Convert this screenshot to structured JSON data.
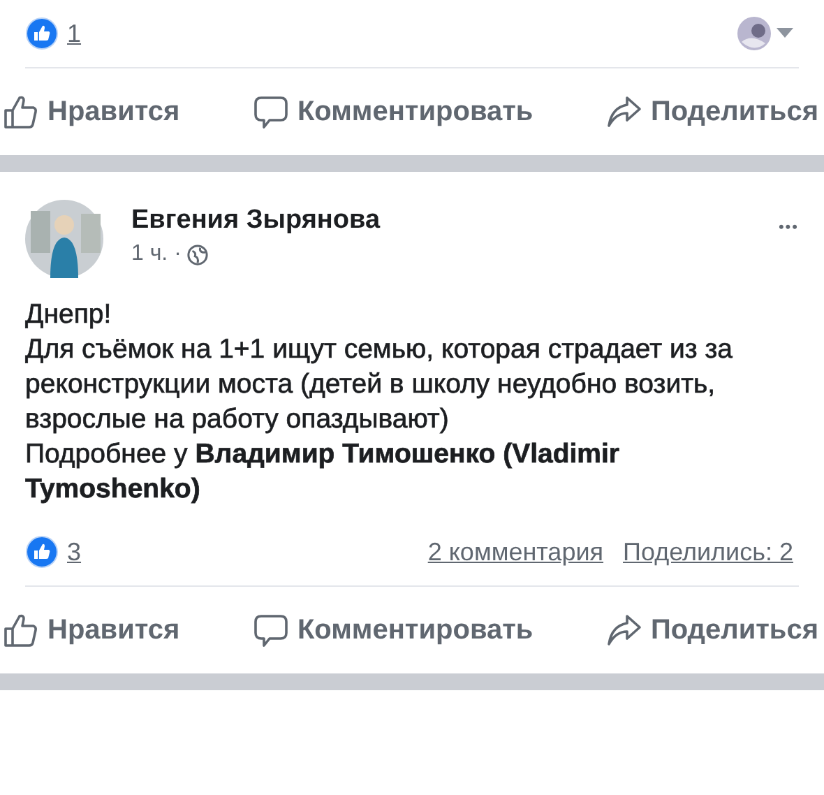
{
  "previous_post": {
    "reactions": {
      "count": "1"
    },
    "actions": [
      {
        "kind": "like",
        "label": "Нравится"
      },
      {
        "kind": "comment",
        "label": "Комментировать"
      },
      {
        "kind": "share",
        "label": "Поделиться"
      }
    ]
  },
  "post": {
    "author": "Евгения Зырянова",
    "time": "1 ч. ·",
    "more": "•••",
    "paragraphs": [
      "Днепр!",
      "Для съёмок на 1+1 ищут семью, которая страдает из за реконструкции моста (детей в школу неудобно возить, взрослые на работу опаздывают)",
      "Подробнее у **Владимир Тимошенко (Vladimir Tymoshenko)**"
    ],
    "reactions": {
      "count": "3"
    },
    "comments": "2 комментария",
    "shares": "Поделились: 2",
    "actions": [
      {
        "kind": "like",
        "label": "Нравится"
      },
      {
        "kind": "comment",
        "label": "Комментировать"
      },
      {
        "kind": "share",
        "label": "Поделиться"
      }
    ]
  }
}
